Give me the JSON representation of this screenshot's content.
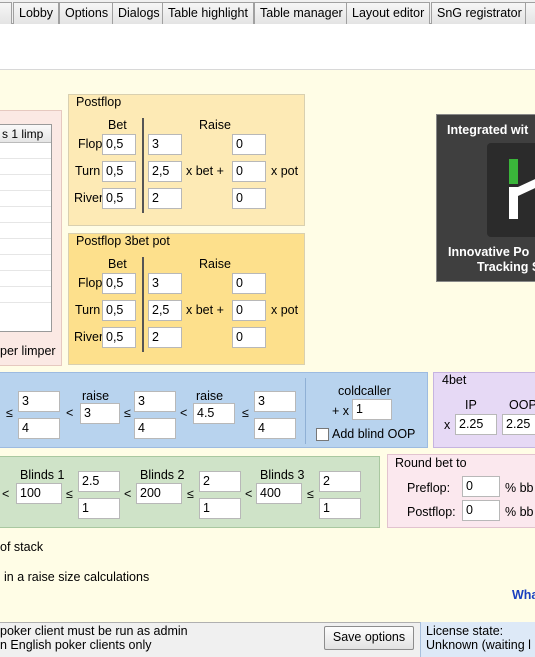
{
  "tabs": [
    "Lobby",
    "Options",
    "Dialogs",
    "Table highlight",
    "Table manager",
    "Layout editor",
    "SnG registrator"
  ],
  "left_list": {
    "header": "s 1 limp",
    "footer": "per limper"
  },
  "postflop": {
    "title": "Postflop",
    "bet_label": "Bet",
    "raise_label": "Raise",
    "rows": [
      {
        "label": "Flop",
        "bet": "0,5",
        "raise_bet": "3",
        "raise_pot": "0"
      },
      {
        "label": "Turn",
        "bet": "0,5",
        "raise_bet": "2,5",
        "raise_pot": "0"
      },
      {
        "label": "River",
        "bet": "0,5",
        "raise_bet": "2",
        "raise_pot": "0"
      }
    ],
    "xbet": "x bet +",
    "xpot": "x pot"
  },
  "postflop3bet": {
    "title": "Postflop 3bet pot",
    "bet_label": "Bet",
    "raise_label": "Raise",
    "rows": [
      {
        "label": "Flop",
        "bet": "0,5",
        "raise_bet": "3",
        "raise_pot": "0"
      },
      {
        "label": "Turn",
        "bet": "0,5",
        "raise_bet": "2,5",
        "raise_pot": "0"
      },
      {
        "label": "River",
        "bet": "0,5",
        "raise_bet": "2",
        "raise_pot": "0"
      }
    ],
    "xbet": "x bet +",
    "xpot": "x pot"
  },
  "promo": {
    "title": "Integrated wit",
    "line1": "Innovative Po",
    "line2": "Tracking S"
  },
  "raise_row": {
    "le1": "≤",
    "v1": "3",
    "v2": "4",
    "lt1": "<",
    "raise1_label": "raise",
    "raise1": "3",
    "le2": "≤",
    "v3": "3",
    "v4": "4",
    "lt2": "<",
    "raise2_label": "raise",
    "raise2": "4.5",
    "le3": "≤",
    "v5": "3",
    "v6": "4"
  },
  "coldcaller": {
    "label": "coldcaller",
    "prefix": "+ x",
    "value": "1",
    "checkbox_label": "Add blind OOP"
  },
  "fourbet": {
    "title": "4bet",
    "ip_label": "IP",
    "oop_label": "OOP",
    "x": "x",
    "ip": "2.25",
    "oop": "2.25"
  },
  "blinds": {
    "lt0": "<",
    "b1_label": "Blinds 1",
    "b1": "100",
    "le1": "≤",
    "b1a": "2.5",
    "b1b": "1",
    "lt1": "<",
    "b2_label": "Blinds 2",
    "b2": "200",
    "le2": "≤",
    "b2a": "2",
    "b2b": "1",
    "lt2": "<",
    "b3_label": "Blinds 3",
    "b3": "400",
    "le3": "≤",
    "b3a": "2",
    "b3b": "1"
  },
  "roundbet": {
    "title": "Round bet to",
    "preflop_label": "Preflop:",
    "preflop": "0",
    "postflop_label": "Postflop:",
    "postflop": "0",
    "unit": "% bb"
  },
  "notes": {
    "of_stack": "of stack",
    "raise_calc": "in a raise size calculations",
    "link": "Wha"
  },
  "status": {
    "line1": "poker client must be run as admin",
    "line2": "n English poker clients only",
    "save": "Save options",
    "license_label": "License state:",
    "license_value": "Unknown (waiting l"
  },
  "colors": {
    "postflop_bg": "#fdeab5",
    "blue_panel": "#b8d3ee",
    "purple_panel": "#e6d9f5",
    "green_panel": "#cfe3c8"
  }
}
